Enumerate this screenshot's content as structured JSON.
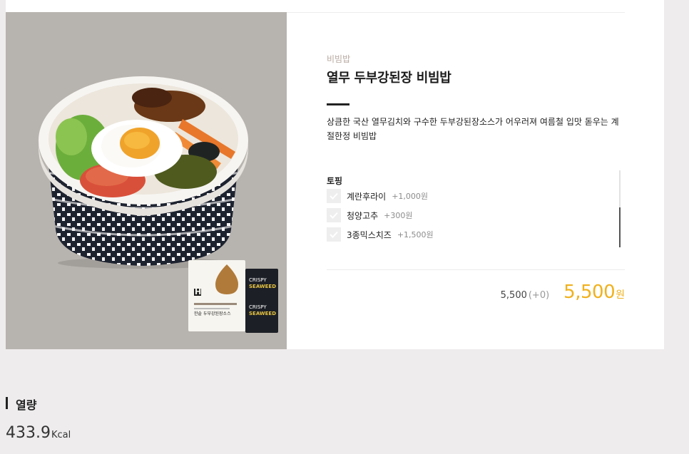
{
  "product": {
    "category": "비빔밥",
    "title": "열무 두부강된장 비빔밥",
    "description": "상큼한 국산 열무김치와 구수한 두부강된장소스가 어우러져 여름철 입맛 돋우는 계절한정 비빔밥"
  },
  "topping": {
    "label": "토핑",
    "options": [
      {
        "name": "계란후라이",
        "price": "+1,000원"
      },
      {
        "name": "청양고추",
        "price": "+300원"
      },
      {
        "name": "3종믹스치즈",
        "price": "+1,500원"
      }
    ]
  },
  "price": {
    "base": "5,500",
    "added": "(+0)",
    "total": "5,500",
    "unit": "원"
  },
  "calorie": {
    "label": "열량",
    "value": "433.9",
    "unit": "Kcal"
  },
  "packet": {
    "sauce_brand": "H",
    "sauce_label": "한솥 두부강된장소스",
    "seaweed_line1": "CRISPY",
    "seaweed_line2": "SEAWEED"
  },
  "colors": {
    "accent": "#f0b11e",
    "photo_bg": "#b7b3ae"
  }
}
